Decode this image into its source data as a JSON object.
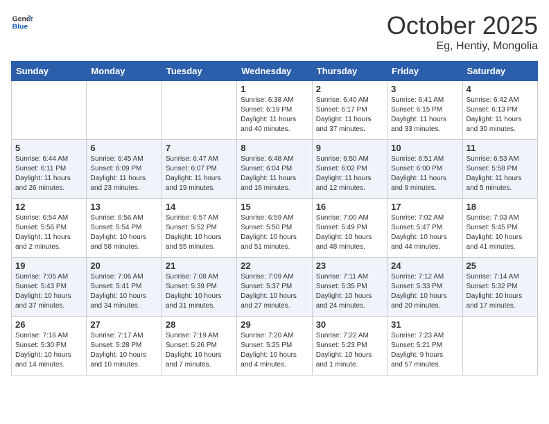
{
  "header": {
    "logo_line1": "General",
    "logo_line2": "Blue",
    "month": "October 2025",
    "location": "Eg, Hentiy, Mongolia"
  },
  "days_of_week": [
    "Sunday",
    "Monday",
    "Tuesday",
    "Wednesday",
    "Thursday",
    "Friday",
    "Saturday"
  ],
  "weeks": [
    [
      {
        "day": "",
        "info": ""
      },
      {
        "day": "",
        "info": ""
      },
      {
        "day": "",
        "info": ""
      },
      {
        "day": "1",
        "info": "Sunrise: 6:38 AM\nSunset: 6:19 PM\nDaylight: 11 hours\nand 40 minutes."
      },
      {
        "day": "2",
        "info": "Sunrise: 6:40 AM\nSunset: 6:17 PM\nDaylight: 11 hours\nand 37 minutes."
      },
      {
        "day": "3",
        "info": "Sunrise: 6:41 AM\nSunset: 6:15 PM\nDaylight: 11 hours\nand 33 minutes."
      },
      {
        "day": "4",
        "info": "Sunrise: 6:42 AM\nSunset: 6:13 PM\nDaylight: 11 hours\nand 30 minutes."
      }
    ],
    [
      {
        "day": "5",
        "info": "Sunrise: 6:44 AM\nSunset: 6:11 PM\nDaylight: 11 hours\nand 26 minutes."
      },
      {
        "day": "6",
        "info": "Sunrise: 6:45 AM\nSunset: 6:09 PM\nDaylight: 11 hours\nand 23 minutes."
      },
      {
        "day": "7",
        "info": "Sunrise: 6:47 AM\nSunset: 6:07 PM\nDaylight: 11 hours\nand 19 minutes."
      },
      {
        "day": "8",
        "info": "Sunrise: 6:48 AM\nSunset: 6:04 PM\nDaylight: 11 hours\nand 16 minutes."
      },
      {
        "day": "9",
        "info": "Sunrise: 6:50 AM\nSunset: 6:02 PM\nDaylight: 11 hours\nand 12 minutes."
      },
      {
        "day": "10",
        "info": "Sunrise: 6:51 AM\nSunset: 6:00 PM\nDaylight: 11 hours\nand 9 minutes."
      },
      {
        "day": "11",
        "info": "Sunrise: 6:53 AM\nSunset: 5:58 PM\nDaylight: 11 hours\nand 5 minutes."
      }
    ],
    [
      {
        "day": "12",
        "info": "Sunrise: 6:54 AM\nSunset: 5:56 PM\nDaylight: 11 hours\nand 2 minutes."
      },
      {
        "day": "13",
        "info": "Sunrise: 6:56 AM\nSunset: 5:54 PM\nDaylight: 10 hours\nand 58 minutes."
      },
      {
        "day": "14",
        "info": "Sunrise: 6:57 AM\nSunset: 5:52 PM\nDaylight: 10 hours\nand 55 minutes."
      },
      {
        "day": "15",
        "info": "Sunrise: 6:59 AM\nSunset: 5:50 PM\nDaylight: 10 hours\nand 51 minutes."
      },
      {
        "day": "16",
        "info": "Sunrise: 7:00 AM\nSunset: 5:49 PM\nDaylight: 10 hours\nand 48 minutes."
      },
      {
        "day": "17",
        "info": "Sunrise: 7:02 AM\nSunset: 5:47 PM\nDaylight: 10 hours\nand 44 minutes."
      },
      {
        "day": "18",
        "info": "Sunrise: 7:03 AM\nSunset: 5:45 PM\nDaylight: 10 hours\nand 41 minutes."
      }
    ],
    [
      {
        "day": "19",
        "info": "Sunrise: 7:05 AM\nSunset: 5:43 PM\nDaylight: 10 hours\nand 37 minutes."
      },
      {
        "day": "20",
        "info": "Sunrise: 7:06 AM\nSunset: 5:41 PM\nDaylight: 10 hours\nand 34 minutes."
      },
      {
        "day": "21",
        "info": "Sunrise: 7:08 AM\nSunset: 5:39 PM\nDaylight: 10 hours\nand 31 minutes."
      },
      {
        "day": "22",
        "info": "Sunrise: 7:09 AM\nSunset: 5:37 PM\nDaylight: 10 hours\nand 27 minutes."
      },
      {
        "day": "23",
        "info": "Sunrise: 7:11 AM\nSunset: 5:35 PM\nDaylight: 10 hours\nand 24 minutes."
      },
      {
        "day": "24",
        "info": "Sunrise: 7:12 AM\nSunset: 5:33 PM\nDaylight: 10 hours\nand 20 minutes."
      },
      {
        "day": "25",
        "info": "Sunrise: 7:14 AM\nSunset: 5:32 PM\nDaylight: 10 hours\nand 17 minutes."
      }
    ],
    [
      {
        "day": "26",
        "info": "Sunrise: 7:16 AM\nSunset: 5:30 PM\nDaylight: 10 hours\nand 14 minutes."
      },
      {
        "day": "27",
        "info": "Sunrise: 7:17 AM\nSunset: 5:28 PM\nDaylight: 10 hours\nand 10 minutes."
      },
      {
        "day": "28",
        "info": "Sunrise: 7:19 AM\nSunset: 5:26 PM\nDaylight: 10 hours\nand 7 minutes."
      },
      {
        "day": "29",
        "info": "Sunrise: 7:20 AM\nSunset: 5:25 PM\nDaylight: 10 hours\nand 4 minutes."
      },
      {
        "day": "30",
        "info": "Sunrise: 7:22 AM\nSunset: 5:23 PM\nDaylight: 10 hours\nand 1 minute."
      },
      {
        "day": "31",
        "info": "Sunrise: 7:23 AM\nSunset: 5:21 PM\nDaylight: 9 hours\nand 57 minutes."
      },
      {
        "day": "",
        "info": ""
      }
    ]
  ]
}
